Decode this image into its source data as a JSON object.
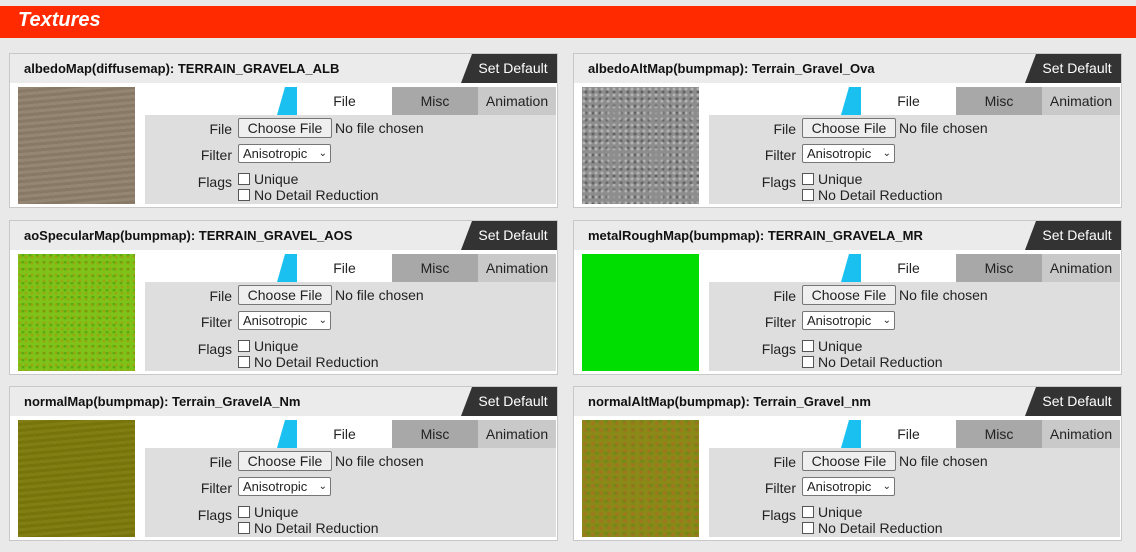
{
  "header": {
    "title": "Textures"
  },
  "common": {
    "set_default": "Set Default",
    "tabs": {
      "file": "File",
      "misc": "Misc",
      "animation": "Animation"
    },
    "file_label": "File",
    "choose_file": "Choose File",
    "no_file": "No file chosen",
    "filter_label": "Filter",
    "filter_value": "Anisotropic",
    "flags_label": "Flags",
    "flag_unique": "Unique",
    "flag_no_detail": "No Detail Reduction"
  },
  "panels": [
    {
      "title": "albedoMap(diffusemap): TERRAIN_GRAVELA_ALB",
      "swatch_color": "#8f7f6c"
    },
    {
      "title": "albedoAltMap(bumpmap): Terrain_Gravel_Ova",
      "swatch_color": "#8d8d8d"
    },
    {
      "title": "aoSpecularMap(bumpmap): TERRAIN_GRAVEL_AOS",
      "swatch_color": "#7ec21a"
    },
    {
      "title": "metalRoughMap(bumpmap): TERRAIN_GRAVELA_MR",
      "swatch_color": "#00dd00"
    },
    {
      "title": "normalMap(bumpmap): Terrain_GravelA_Nm",
      "swatch_color": "#7c7a0a"
    },
    {
      "title": "normalAltMap(bumpmap): Terrain_Gravel_nm",
      "swatch_color": "#8a8a18"
    }
  ]
}
